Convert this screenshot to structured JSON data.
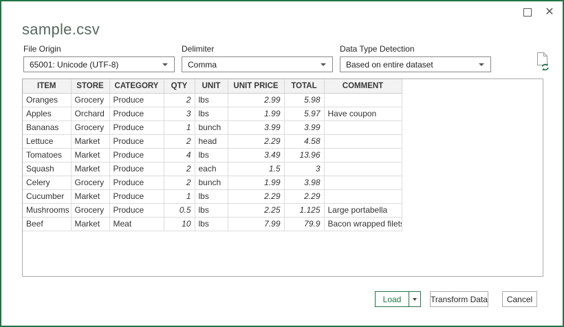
{
  "window": {
    "title": "sample.csv",
    "close_glyph": "✕"
  },
  "form": {
    "file_origin": {
      "label": "File Origin",
      "value": "65001: Unicode (UTF-8)"
    },
    "delimiter": {
      "label": "Delimiter",
      "value": "Comma"
    },
    "data_type_detection": {
      "label": "Data Type Detection",
      "value": "Based on entire dataset"
    }
  },
  "table": {
    "columns": [
      {
        "label": "ITEM",
        "numeric": false
      },
      {
        "label": "STORE",
        "numeric": false
      },
      {
        "label": "CATEGORY",
        "numeric": false
      },
      {
        "label": "QTY",
        "numeric": true
      },
      {
        "label": "UNIT",
        "numeric": false
      },
      {
        "label": "UNIT PRICE",
        "numeric": true
      },
      {
        "label": "TOTAL",
        "numeric": true
      },
      {
        "label": "COMMENT",
        "numeric": false
      }
    ],
    "rows": [
      [
        "Oranges",
        "Grocery",
        "Produce",
        "2",
        "lbs",
        "2.99",
        "5.98",
        ""
      ],
      [
        "Apples",
        "Orchard",
        "Produce",
        "3",
        "lbs",
        "1.99",
        "5.97",
        "Have coupon"
      ],
      [
        "Bananas",
        "Grocery",
        "Produce",
        "1",
        "bunch",
        "3.99",
        "3.99",
        ""
      ],
      [
        "Lettuce",
        "Market",
        "Produce",
        "2",
        "head",
        "2.29",
        "4.58",
        ""
      ],
      [
        "Tomatoes",
        "Market",
        "Produce",
        "4",
        "lbs",
        "3.49",
        "13.96",
        ""
      ],
      [
        "Squash",
        "Market",
        "Produce",
        "2",
        "each",
        "1.5",
        "3",
        ""
      ],
      [
        "Celery",
        "Grocery",
        "Produce",
        "2",
        "bunch",
        "1.99",
        "3.98",
        ""
      ],
      [
        "Cucumber",
        "Market",
        "Produce",
        "1",
        "lbs",
        "2.29",
        "2.29",
        ""
      ],
      [
        "Mushrooms",
        "Grocery",
        "Produce",
        "0.5",
        "lbs",
        "2.25",
        "1.125",
        "Large portabella"
      ],
      [
        "Beef",
        "Market",
        "Meat",
        "10",
        "lbs",
        "7.99",
        "79.9",
        "Bacon wrapped filets"
      ]
    ]
  },
  "buttons": {
    "load": "Load",
    "transform": "Transform Data",
    "cancel": "Cancel"
  },
  "colors": {
    "accent_green": "#217346",
    "button_border_gray": "#ababab",
    "grid_line": "#dcdcdc",
    "header_bg": "#f2f2f2"
  }
}
